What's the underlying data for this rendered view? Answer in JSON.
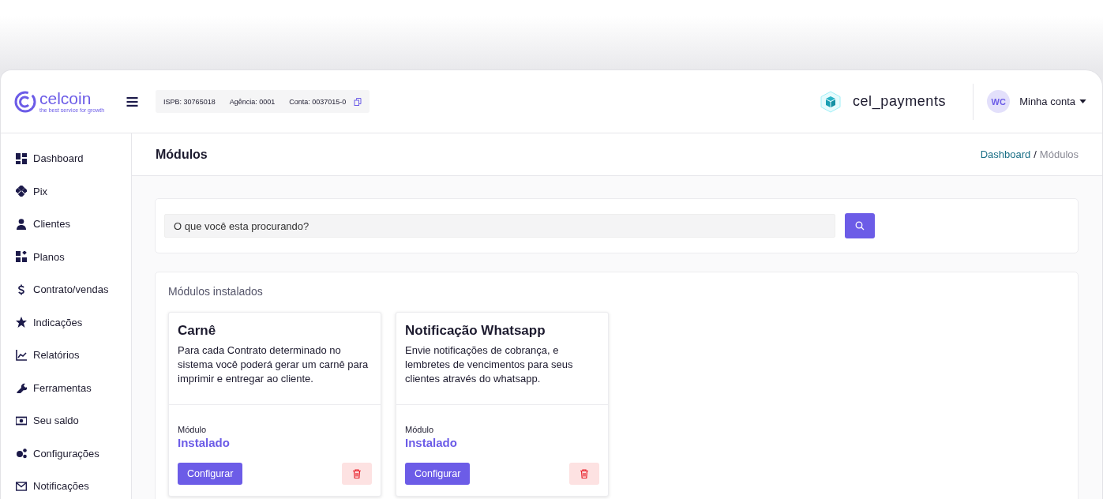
{
  "header": {
    "brand": "celcoin",
    "tagline": "the best service for growth",
    "account_info": [
      "ISPB: 30765018",
      "Agência: 0001",
      "Conta: 0037015-0"
    ],
    "app_name": "cel_payments",
    "avatar": "WC",
    "account_menu": "Minha conta"
  },
  "sidebar": {
    "items": [
      {
        "label": "Dashboard"
      },
      {
        "label": "Pix"
      },
      {
        "label": "Clientes"
      },
      {
        "label": "Planos"
      },
      {
        "label": "Contrato/vendas"
      },
      {
        "label": "Indicações"
      },
      {
        "label": "Relatórios"
      },
      {
        "label": "Ferramentas"
      },
      {
        "label": "Seu saldo"
      },
      {
        "label": "Configurações"
      },
      {
        "label": "Notificações"
      }
    ]
  },
  "page": {
    "title": "Módulos",
    "breadcrumb_separator": "/",
    "breadcrumb": [
      {
        "label": "Dashboard",
        "selected": false
      },
      {
        "label": "Módulos",
        "selected": true
      }
    ]
  },
  "search": {
    "placeholder": "O que você esta procurando?"
  },
  "installed": {
    "title": "Módulos instalados",
    "modules": [
      {
        "name": "Carnê",
        "description": "Para cada Contrato determinado no sistema você poderá gerar um carnê para imprimir e entregar ao cliente.",
        "status_label": "Módulo",
        "status": "Instalado",
        "button": "Configurar"
      },
      {
        "name": "Notificação Whatsapp",
        "description": "Envie notificações de cobrança, e lembretes de vencimentos para seus clientes através do whatsapp.",
        "status_label": "Módulo",
        "status": "Instalado",
        "button": "Configurar"
      }
    ]
  }
}
